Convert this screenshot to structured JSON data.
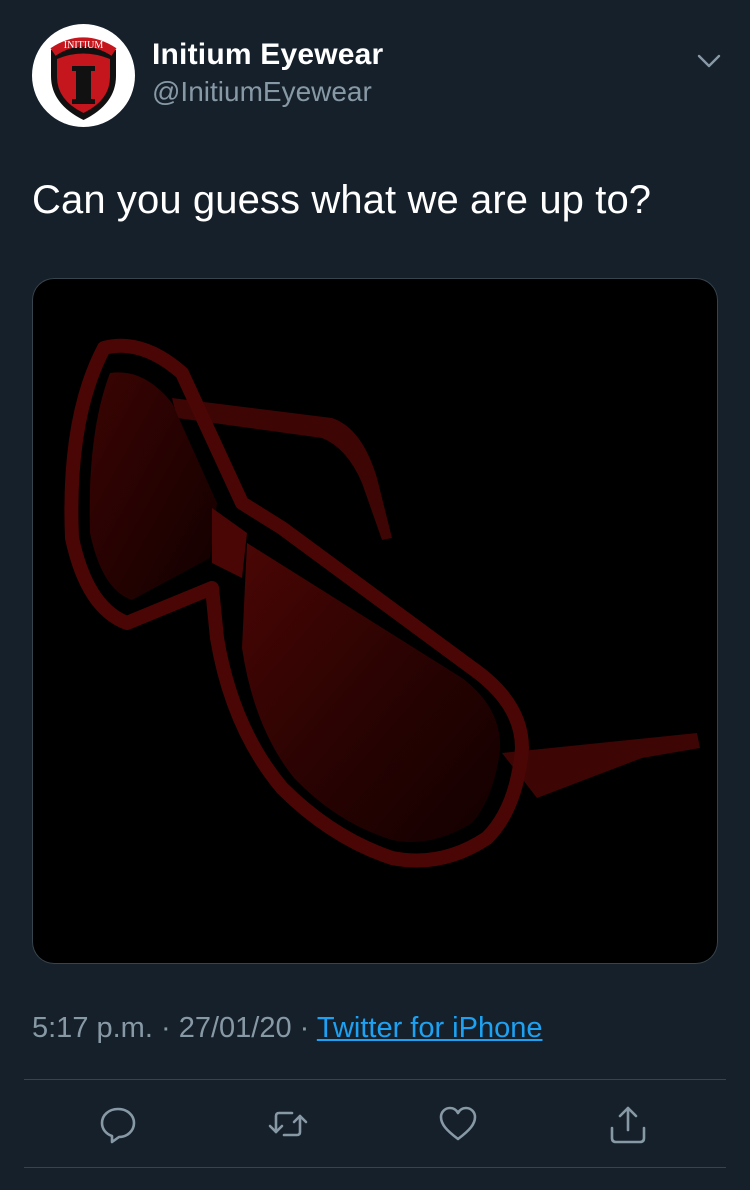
{
  "author": {
    "display_name": "Initium Eyewear",
    "handle": "@InitiumEyewear",
    "avatar_text": "INITIUM",
    "avatar_letter": "I"
  },
  "tweet": {
    "text": "Can you guess what we are up to?",
    "media_alt": "red sunglasses silhouette on black background"
  },
  "meta": {
    "time": "5:17 p.m.",
    "separator": " · ",
    "date": "27/01/20",
    "source": "Twitter for iPhone"
  },
  "icons": {
    "menu": "chevron-down-icon",
    "reply": "reply-icon",
    "retweet": "retweet-icon",
    "like": "heart-icon",
    "share": "share-icon"
  },
  "colors": {
    "background": "#15202b",
    "secondary_text": "#8899a6",
    "link": "#1da1f2",
    "divider": "#38444d",
    "brand_red": "#c4161c"
  }
}
